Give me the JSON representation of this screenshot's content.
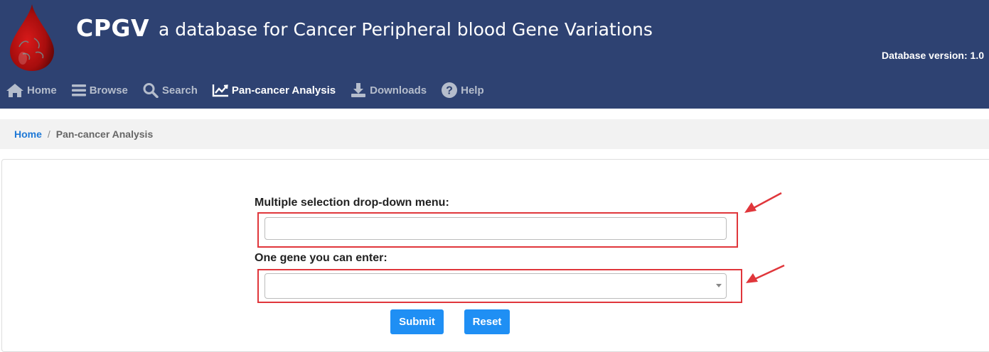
{
  "header": {
    "brand": "CPGV",
    "tagline": "a database for Cancer Peripheral blood Gene Variations",
    "version": "Database version: 1.0",
    "bg_color": "#2e4272"
  },
  "nav": {
    "items": [
      {
        "label": "Home",
        "icon": "home-icon"
      },
      {
        "label": "Browse",
        "icon": "bars-icon"
      },
      {
        "label": "Search",
        "icon": "search-icon"
      },
      {
        "label": "Pan-cancer Analysis",
        "icon": "line-chart-icon",
        "active": true
      },
      {
        "label": "Downloads",
        "icon": "download-icon"
      },
      {
        "label": "Help",
        "icon": "help-icon"
      }
    ]
  },
  "breadcrumb": {
    "home": "Home",
    "separator": "/",
    "current": "Pan-cancer Analysis"
  },
  "form": {
    "multi_label": "Multiple selection drop-down menu:",
    "multi_value": "",
    "gene_label": "One gene you can enter:",
    "gene_value": "",
    "submit_label": "Submit",
    "reset_label": "Reset",
    "button_color": "#1f8ff4",
    "highlight_color": "#e0363b"
  }
}
